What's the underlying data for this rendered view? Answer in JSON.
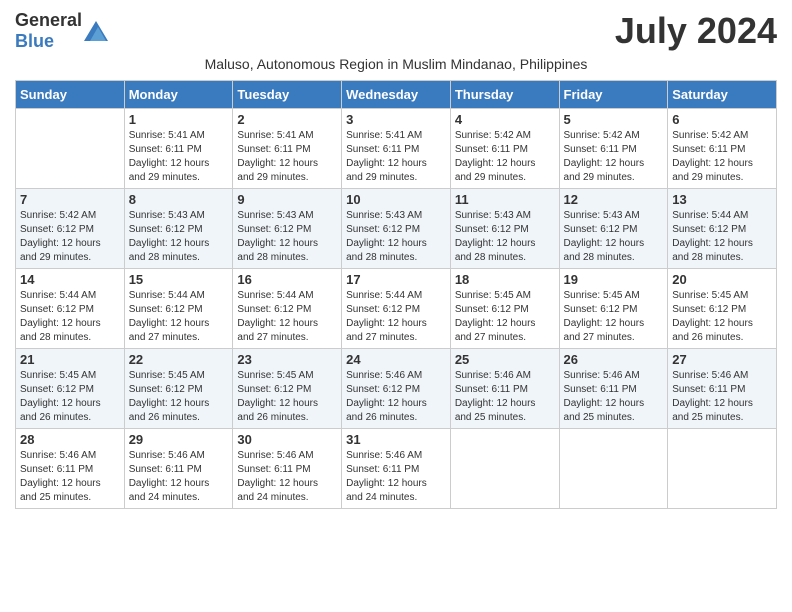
{
  "logo": {
    "general": "General",
    "blue": "Blue"
  },
  "title": "July 2024",
  "subtitle": "Maluso, Autonomous Region in Muslim Mindanao, Philippines",
  "weekdays": [
    "Sunday",
    "Monday",
    "Tuesday",
    "Wednesday",
    "Thursday",
    "Friday",
    "Saturday"
  ],
  "weeks": [
    [
      {
        "day": "",
        "sunrise": "",
        "sunset": "",
        "daylight": ""
      },
      {
        "day": "1",
        "sunrise": "Sunrise: 5:41 AM",
        "sunset": "Sunset: 6:11 PM",
        "daylight": "Daylight: 12 hours and 29 minutes."
      },
      {
        "day": "2",
        "sunrise": "Sunrise: 5:41 AM",
        "sunset": "Sunset: 6:11 PM",
        "daylight": "Daylight: 12 hours and 29 minutes."
      },
      {
        "day": "3",
        "sunrise": "Sunrise: 5:41 AM",
        "sunset": "Sunset: 6:11 PM",
        "daylight": "Daylight: 12 hours and 29 minutes."
      },
      {
        "day": "4",
        "sunrise": "Sunrise: 5:42 AM",
        "sunset": "Sunset: 6:11 PM",
        "daylight": "Daylight: 12 hours and 29 minutes."
      },
      {
        "day": "5",
        "sunrise": "Sunrise: 5:42 AM",
        "sunset": "Sunset: 6:11 PM",
        "daylight": "Daylight: 12 hours and 29 minutes."
      },
      {
        "day": "6",
        "sunrise": "Sunrise: 5:42 AM",
        "sunset": "Sunset: 6:11 PM",
        "daylight": "Daylight: 12 hours and 29 minutes."
      }
    ],
    [
      {
        "day": "7",
        "sunrise": "Sunrise: 5:42 AM",
        "sunset": "Sunset: 6:12 PM",
        "daylight": "Daylight: 12 hours and 29 minutes."
      },
      {
        "day": "8",
        "sunrise": "Sunrise: 5:43 AM",
        "sunset": "Sunset: 6:12 PM",
        "daylight": "Daylight: 12 hours and 28 minutes."
      },
      {
        "day": "9",
        "sunrise": "Sunrise: 5:43 AM",
        "sunset": "Sunset: 6:12 PM",
        "daylight": "Daylight: 12 hours and 28 minutes."
      },
      {
        "day": "10",
        "sunrise": "Sunrise: 5:43 AM",
        "sunset": "Sunset: 6:12 PM",
        "daylight": "Daylight: 12 hours and 28 minutes."
      },
      {
        "day": "11",
        "sunrise": "Sunrise: 5:43 AM",
        "sunset": "Sunset: 6:12 PM",
        "daylight": "Daylight: 12 hours and 28 minutes."
      },
      {
        "day": "12",
        "sunrise": "Sunrise: 5:43 AM",
        "sunset": "Sunset: 6:12 PM",
        "daylight": "Daylight: 12 hours and 28 minutes."
      },
      {
        "day": "13",
        "sunrise": "Sunrise: 5:44 AM",
        "sunset": "Sunset: 6:12 PM",
        "daylight": "Daylight: 12 hours and 28 minutes."
      }
    ],
    [
      {
        "day": "14",
        "sunrise": "Sunrise: 5:44 AM",
        "sunset": "Sunset: 6:12 PM",
        "daylight": "Daylight: 12 hours and 28 minutes."
      },
      {
        "day": "15",
        "sunrise": "Sunrise: 5:44 AM",
        "sunset": "Sunset: 6:12 PM",
        "daylight": "Daylight: 12 hours and 27 minutes."
      },
      {
        "day": "16",
        "sunrise": "Sunrise: 5:44 AM",
        "sunset": "Sunset: 6:12 PM",
        "daylight": "Daylight: 12 hours and 27 minutes."
      },
      {
        "day": "17",
        "sunrise": "Sunrise: 5:44 AM",
        "sunset": "Sunset: 6:12 PM",
        "daylight": "Daylight: 12 hours and 27 minutes."
      },
      {
        "day": "18",
        "sunrise": "Sunrise: 5:45 AM",
        "sunset": "Sunset: 6:12 PM",
        "daylight": "Daylight: 12 hours and 27 minutes."
      },
      {
        "day": "19",
        "sunrise": "Sunrise: 5:45 AM",
        "sunset": "Sunset: 6:12 PM",
        "daylight": "Daylight: 12 hours and 27 minutes."
      },
      {
        "day": "20",
        "sunrise": "Sunrise: 5:45 AM",
        "sunset": "Sunset: 6:12 PM",
        "daylight": "Daylight: 12 hours and 26 minutes."
      }
    ],
    [
      {
        "day": "21",
        "sunrise": "Sunrise: 5:45 AM",
        "sunset": "Sunset: 6:12 PM",
        "daylight": "Daylight: 12 hours and 26 minutes."
      },
      {
        "day": "22",
        "sunrise": "Sunrise: 5:45 AM",
        "sunset": "Sunset: 6:12 PM",
        "daylight": "Daylight: 12 hours and 26 minutes."
      },
      {
        "day": "23",
        "sunrise": "Sunrise: 5:45 AM",
        "sunset": "Sunset: 6:12 PM",
        "daylight": "Daylight: 12 hours and 26 minutes."
      },
      {
        "day": "24",
        "sunrise": "Sunrise: 5:46 AM",
        "sunset": "Sunset: 6:12 PM",
        "daylight": "Daylight: 12 hours and 26 minutes."
      },
      {
        "day": "25",
        "sunrise": "Sunrise: 5:46 AM",
        "sunset": "Sunset: 6:11 PM",
        "daylight": "Daylight: 12 hours and 25 minutes."
      },
      {
        "day": "26",
        "sunrise": "Sunrise: 5:46 AM",
        "sunset": "Sunset: 6:11 PM",
        "daylight": "Daylight: 12 hours and 25 minutes."
      },
      {
        "day": "27",
        "sunrise": "Sunrise: 5:46 AM",
        "sunset": "Sunset: 6:11 PM",
        "daylight": "Daylight: 12 hours and 25 minutes."
      }
    ],
    [
      {
        "day": "28",
        "sunrise": "Sunrise: 5:46 AM",
        "sunset": "Sunset: 6:11 PM",
        "daylight": "Daylight: 12 hours and 25 minutes."
      },
      {
        "day": "29",
        "sunrise": "Sunrise: 5:46 AM",
        "sunset": "Sunset: 6:11 PM",
        "daylight": "Daylight: 12 hours and 24 minutes."
      },
      {
        "day": "30",
        "sunrise": "Sunrise: 5:46 AM",
        "sunset": "Sunset: 6:11 PM",
        "daylight": "Daylight: 12 hours and 24 minutes."
      },
      {
        "day": "31",
        "sunrise": "Sunrise: 5:46 AM",
        "sunset": "Sunset: 6:11 PM",
        "daylight": "Daylight: 12 hours and 24 minutes."
      },
      {
        "day": "",
        "sunrise": "",
        "sunset": "",
        "daylight": ""
      },
      {
        "day": "",
        "sunrise": "",
        "sunset": "",
        "daylight": ""
      },
      {
        "day": "",
        "sunrise": "",
        "sunset": "",
        "daylight": ""
      }
    ]
  ]
}
